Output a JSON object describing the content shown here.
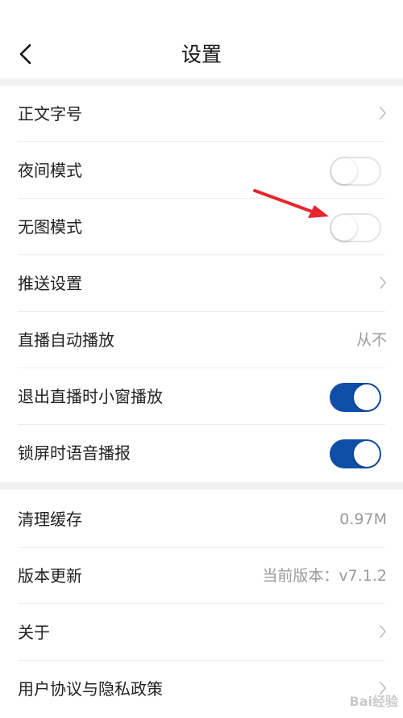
{
  "header": {
    "title": "设置"
  },
  "section1": {
    "font_size": {
      "label": "正文字号"
    },
    "night_mode": {
      "label": "夜间模式",
      "enabled": false
    },
    "no_image_mode": {
      "label": "无图模式",
      "enabled": false
    },
    "push_settings": {
      "label": "推送设置"
    },
    "live_autoplay": {
      "label": "直播自动播放",
      "value": "从不"
    },
    "live_mini_window": {
      "label": "退出直播时小窗播放",
      "enabled": true
    },
    "lock_screen_voice": {
      "label": "锁屏时语音播报",
      "enabled": true
    }
  },
  "section2": {
    "clear_cache": {
      "label": "清理缓存",
      "value": "0.97M"
    },
    "version_update": {
      "label": "版本更新",
      "value": "当前版本：v7.1.2"
    },
    "about": {
      "label": "关于"
    },
    "user_agreement": {
      "label": "用户协议与隐私政策"
    }
  },
  "watermark": "Bai经验",
  "colors": {
    "toggle_on": "#0f4ea6",
    "annotation_arrow": "#e8262d"
  }
}
